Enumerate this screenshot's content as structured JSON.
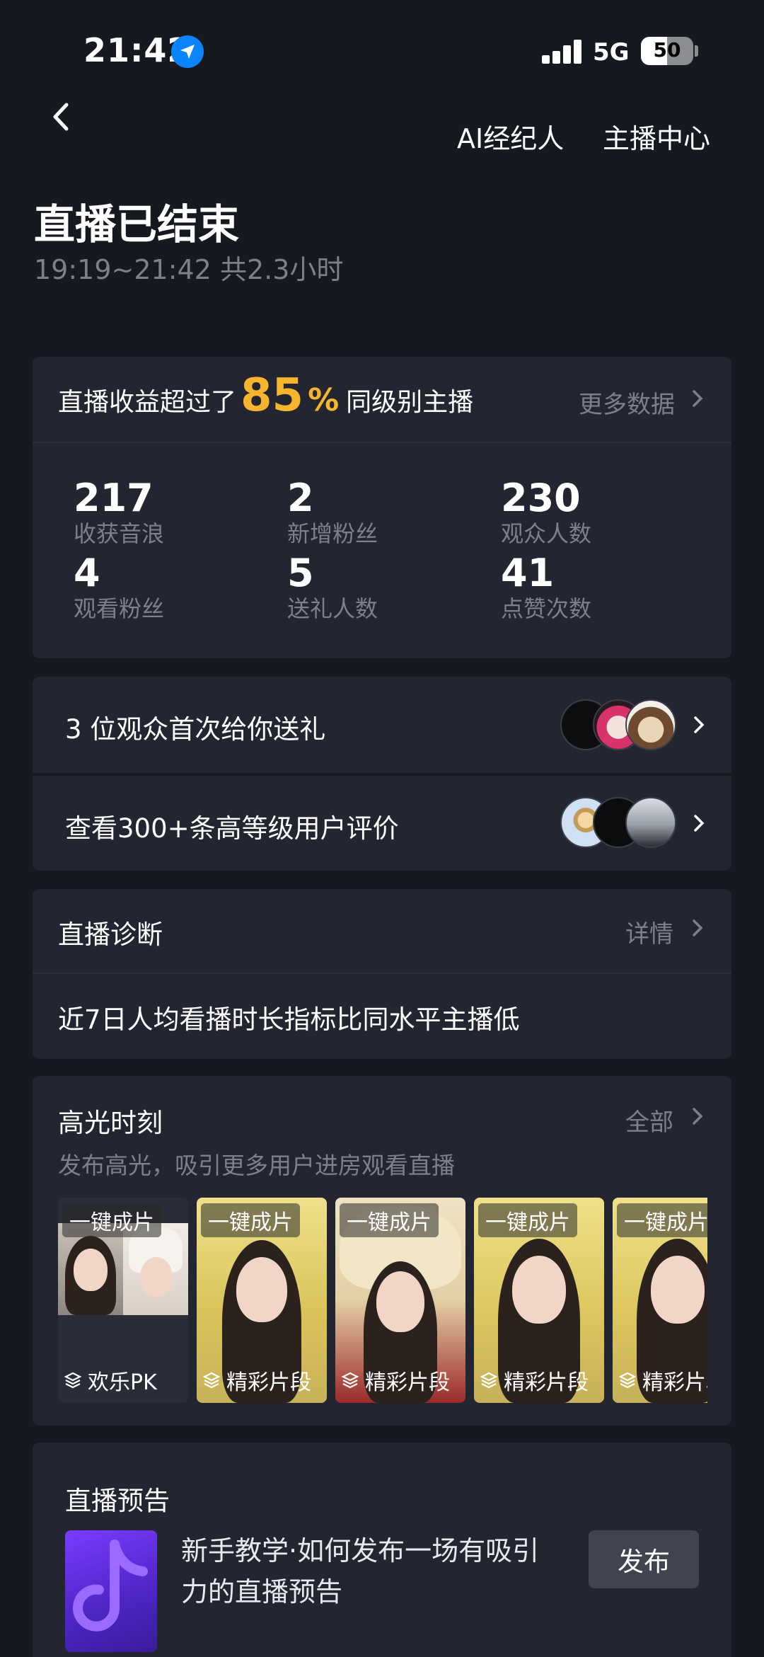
{
  "status_bar": {
    "time": "21:42",
    "network": "5G",
    "battery": "50",
    "battery_level": 0.5
  },
  "header": {
    "ai_agent": "AI经纪人",
    "streamer_center": "主播中心"
  },
  "page": {
    "title": "直播已结束",
    "subtitle": "19:19~21:42 共2.3小时"
  },
  "earnings": {
    "prefix": "直播收益超过了",
    "percent_value": "85",
    "percent_sign": "%",
    "suffix": "同级别主播",
    "more_data": "更多数据"
  },
  "stats": [
    {
      "value": "217",
      "label": "收获音浪"
    },
    {
      "value": "2",
      "label": "新增粉丝"
    },
    {
      "value": "230",
      "label": "观众人数"
    },
    {
      "value": "4",
      "label": "观看粉丝"
    },
    {
      "value": "5",
      "label": "送礼人数"
    },
    {
      "value": "41",
      "label": "点赞次数"
    }
  ],
  "gift_row": {
    "text": "3 位观众首次给你送礼"
  },
  "review_row": {
    "text": "查看300+条高等级用户评价"
  },
  "diagnosis": {
    "title": "直播诊断",
    "link": "详情",
    "message": "近7日人均看播时长指标比同水平主播低"
  },
  "highlights": {
    "title": "高光时刻",
    "link": "全部",
    "subtitle": "发布高光，吸引更多用户进房观看直播",
    "items": [
      {
        "badge": "一键成片",
        "caption": "欢乐PK"
      },
      {
        "badge": "一键成片",
        "caption": "精彩片段"
      },
      {
        "badge": "一键成片",
        "caption": "精彩片段"
      },
      {
        "badge": "一键成片",
        "caption": "精彩片段"
      },
      {
        "badge": "一键成片",
        "caption": "精彩片段"
      }
    ]
  },
  "preview": {
    "title": "直播预告",
    "description": "新手教学·如何发布一场有吸引力的直播预告",
    "publish": "发布"
  },
  "colors": {
    "background": "#171921",
    "card": "#232630",
    "accent": "#f7b52e",
    "muted": "#7d808a"
  }
}
